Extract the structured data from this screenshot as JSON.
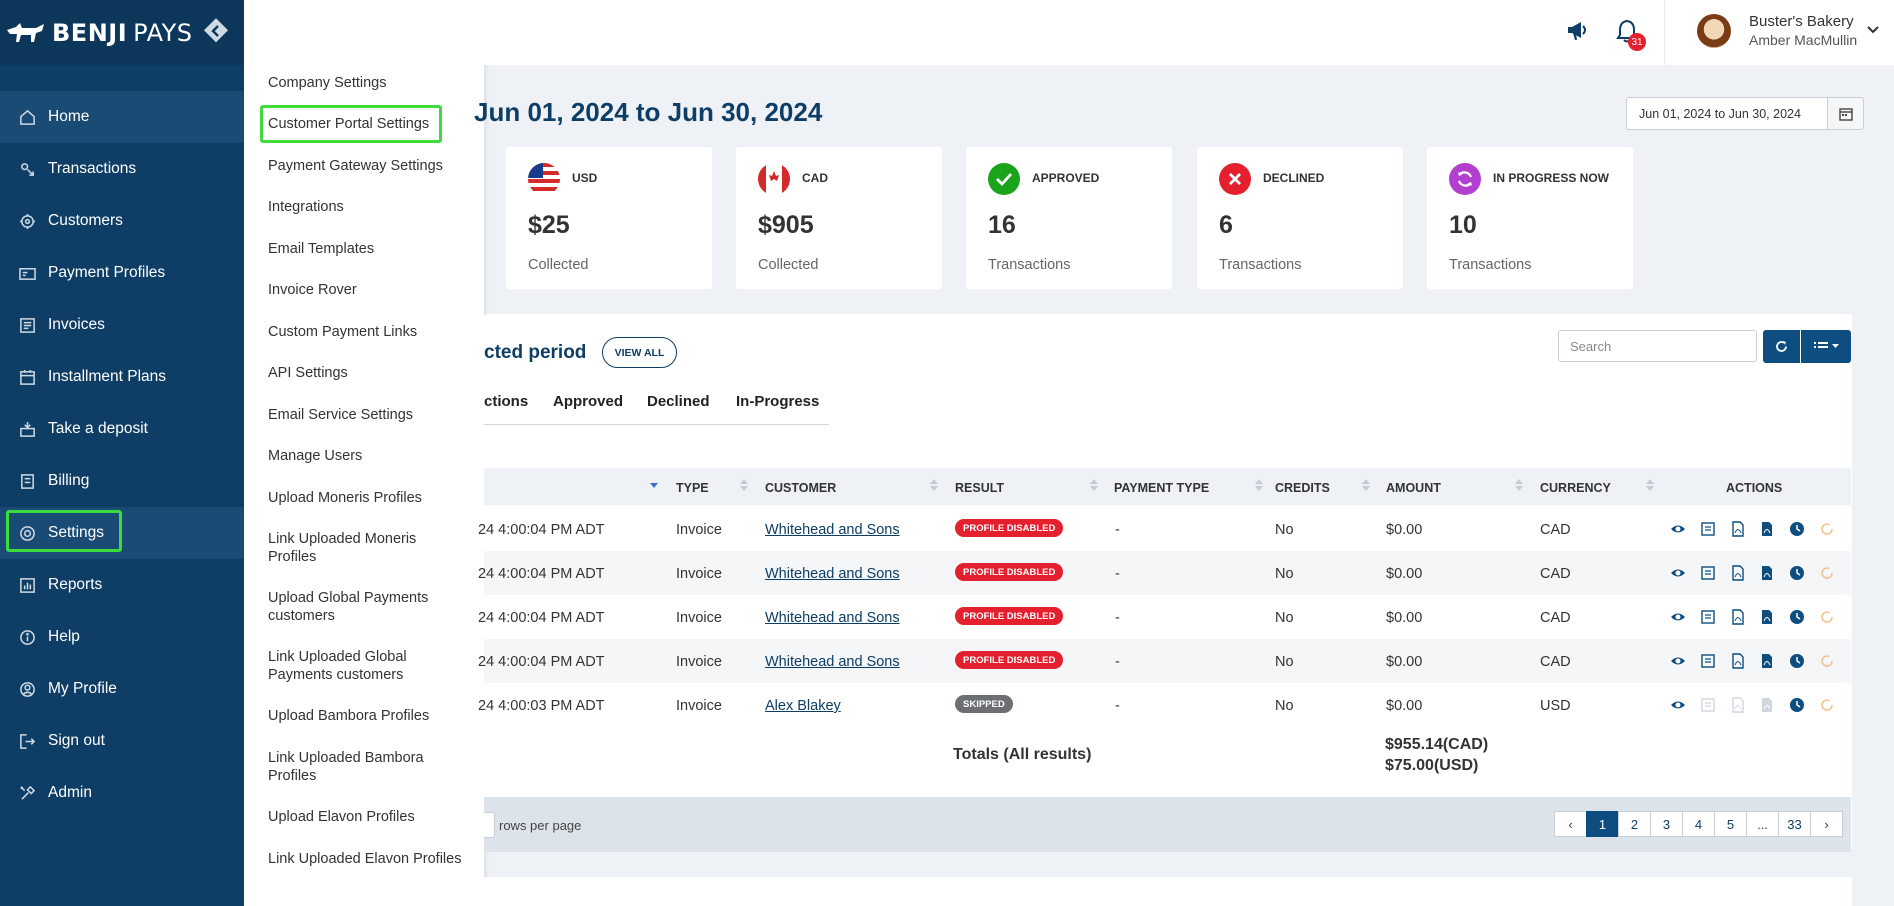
{
  "brand": {
    "name_bold": "BENJI",
    "name_light": "PAYS"
  },
  "sidebar": {
    "items": [
      {
        "label": "Home",
        "icon": "home-icon"
      },
      {
        "label": "Transactions",
        "icon": "transactions-icon"
      },
      {
        "label": "Customers",
        "icon": "customers-icon"
      },
      {
        "label": "Payment Profiles",
        "icon": "payment-profiles-icon"
      },
      {
        "label": "Invoices",
        "icon": "invoices-icon"
      },
      {
        "label": "Installment Plans",
        "icon": "calendar-icon"
      },
      {
        "label": "Take a deposit",
        "icon": "deposit-icon"
      },
      {
        "label": "Billing",
        "icon": "billing-icon"
      },
      {
        "label": "Settings",
        "icon": "gear-icon"
      },
      {
        "label": "Reports",
        "icon": "reports-icon"
      },
      {
        "label": "Help",
        "icon": "help-icon"
      },
      {
        "label": "My Profile",
        "icon": "profile-icon"
      },
      {
        "label": "Sign out",
        "icon": "sign-out-icon"
      },
      {
        "label": "Admin",
        "icon": "admin-icon"
      }
    ]
  },
  "settings_menu": {
    "items": [
      "Company Settings",
      "Customer Portal Settings",
      "Payment Gateway Settings",
      "Integrations",
      "Email Templates",
      "Invoice Rover",
      "Custom Payment Links",
      "API Settings",
      "Email Service Settings",
      "Manage Users",
      "Upload Moneris Profiles",
      "Link Uploaded Moneris Profiles",
      "Upload Global Payments customers",
      "Link Uploaded Global Payments customers",
      "Upload Bambora Profiles",
      "Link Uploaded Bambora Profiles",
      "Upload Elavon Profiles",
      "Link Uploaded Elavon Profiles"
    ]
  },
  "header": {
    "notification_count": "31",
    "company": "Buster's Bakery",
    "user": "Amber MacMullin"
  },
  "main": {
    "period_title": "Jun 01, 2024 to Jun 30, 2024",
    "date_range_value": "Jun 01, 2024 to Jun 30, 2024",
    "cards": [
      {
        "label": "USD",
        "value": "$25",
        "sub": "Collected",
        "icon": "us-flag-icon"
      },
      {
        "label": "CAD",
        "value": "$905",
        "sub": "Collected",
        "icon": "canada-flag-icon"
      },
      {
        "label": "APPROVED",
        "value": "16",
        "sub": "Transactions",
        "icon": "check-icon",
        "color": "#1ba31b"
      },
      {
        "label": "DECLINED",
        "value": "6",
        "sub": "Transactions",
        "icon": "x-icon",
        "color": "#e5202e"
      },
      {
        "label": "IN PROGRESS NOW",
        "value": "10",
        "sub": "Transactions",
        "icon": "sync-icon",
        "color": "#b23fcf"
      }
    ],
    "panel_title": "cted period",
    "view_all": "VIEW ALL",
    "search_placeholder": "Search",
    "tabs": [
      "ctions",
      "Approved",
      "Declined",
      "In-Progress"
    ],
    "columns": [
      "TYPE",
      "CUSTOMER",
      "RESULT",
      "PAYMENT TYPE",
      "CREDITS",
      "AMOUNT",
      "CURRENCY",
      "ACTIONS"
    ],
    "rows": [
      {
        "date": "24 4:00:04 PM ADT",
        "type": "Invoice",
        "customer": "Whitehead and Sons",
        "result": "PROFILE DISABLED",
        "payment_type": "-",
        "credits": "No",
        "amount": "$0.00",
        "currency": "CAD"
      },
      {
        "date": "24 4:00:04 PM ADT",
        "type": "Invoice",
        "customer": "Whitehead and Sons",
        "result": "PROFILE DISABLED",
        "payment_type": "-",
        "credits": "No",
        "amount": "$0.00",
        "currency": "CAD"
      },
      {
        "date": "24 4:00:04 PM ADT",
        "type": "Invoice",
        "customer": "Whitehead and Sons",
        "result": "PROFILE DISABLED",
        "payment_type": "-",
        "credits": "No",
        "amount": "$0.00",
        "currency": "CAD"
      },
      {
        "date": "24 4:00:04 PM ADT",
        "type": "Invoice",
        "customer": "Whitehead and Sons",
        "result": "PROFILE DISABLED",
        "payment_type": "-",
        "credits": "No",
        "amount": "$0.00",
        "currency": "CAD"
      },
      {
        "date": "24 4:00:03 PM ADT",
        "type": "Invoice",
        "customer": "Alex Blakey",
        "result": "SKIPPED",
        "payment_type": "-",
        "credits": "No",
        "amount": "$0.00",
        "currency": "USD"
      }
    ],
    "totals_label": "Totals (All results)",
    "totals_cad": "$955.14(CAD)",
    "totals_usd": "$75.00(USD)",
    "rows_per_page": "rows per page",
    "pages": [
      "‹",
      "1",
      "2",
      "3",
      "4",
      "5",
      "...",
      "33",
      "›"
    ],
    "active_page": "1"
  },
  "colors": {
    "sidebar": "#0e3e66",
    "accent": "#0e4d80",
    "highlight": "#3ddc3d",
    "danger": "#e5202e"
  }
}
